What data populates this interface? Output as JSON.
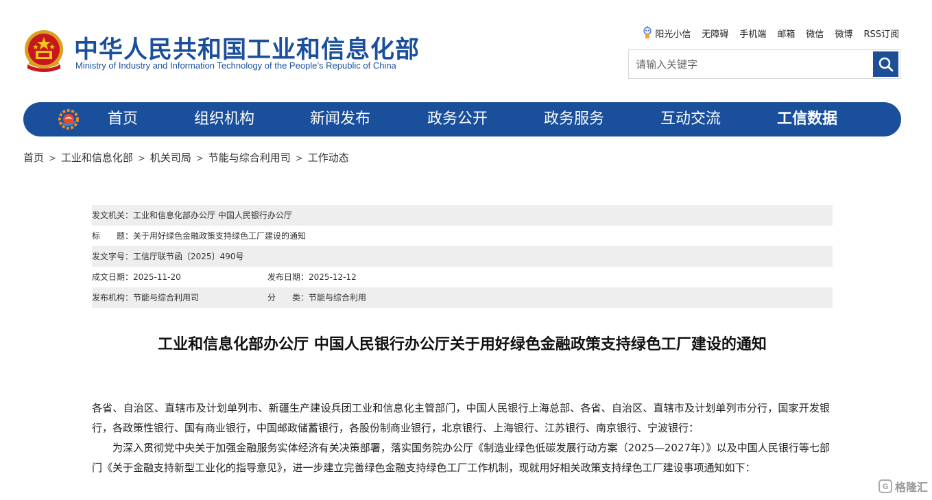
{
  "header": {
    "site_title": "中华人民共和国工业和信息化部",
    "site_subtitle": "Ministry of Industry and Information Technology of the People’s Republic of China",
    "top_links": [
      "阳光小信",
      "无障碍",
      "手机端",
      "邮箱",
      "微信",
      "微博",
      "RSS订阅"
    ],
    "search_placeholder": "请输入关键字"
  },
  "nav": {
    "items": [
      "首页",
      "组织机构",
      "新闻发布",
      "政务公开",
      "政务服务",
      "互动交流",
      "工信数据"
    ]
  },
  "breadcrumb": [
    "首页",
    "工业和信息化部",
    "机关司局",
    "节能与综合利用司",
    "工作动态"
  ],
  "meta": {
    "issuer_label": "发文机关：",
    "issuer": "工业和信息化部办公厅 中国人民银行办公厅",
    "title_label": "标　　题：",
    "title": "关于用好绿色金融政策支持绿色工厂建设的通知",
    "doc_no_label": "发文字号：",
    "doc_no": "工信厅联节函〔2025〕490号",
    "written_label": "成文日期：",
    "written_date": "2025-11-20",
    "publish_label": "发布日期：",
    "publish_date": "2025-12-12",
    "org_label": "发布机构：",
    "org": "节能与综合利用司",
    "category_label": "分　　类：",
    "category": "节能与综合利用"
  },
  "article": {
    "title": "工业和信息化部办公厅 中国人民银行办公厅关于用好绿色金融政策支持绿色工厂建设的通知",
    "para1": "各省、自治区、直辖市及计划单列市、新疆生产建设兵团工业和信息化主管部门，中国人民银行上海总部、各省、自治区、直辖市及计划单列市分行，国家开发银行，各政策性银行、国有商业银行，中国邮政储蓄银行，各股份制商业银行，北京银行、上海银行、江苏银行、南京银行、宁波银行：",
    "para2": "为深入贯彻党中央关于加强金融服务实体经济有关决策部署，落实国务院办公厅《制造业绿色低碳发展行动方案（2025—2027年）》以及中国人民银行等七部门《关于金融支持新型工业化的指导意见》，进一步建立完善绿色金融支持绿色工厂工作机制，现就用好相关政策支持绿色工厂建设事项通知如下："
  },
  "watermark": "格隆汇",
  "colors": {
    "brand_blue": "#1a4f9c",
    "meta_shade": "#eeeeee"
  }
}
